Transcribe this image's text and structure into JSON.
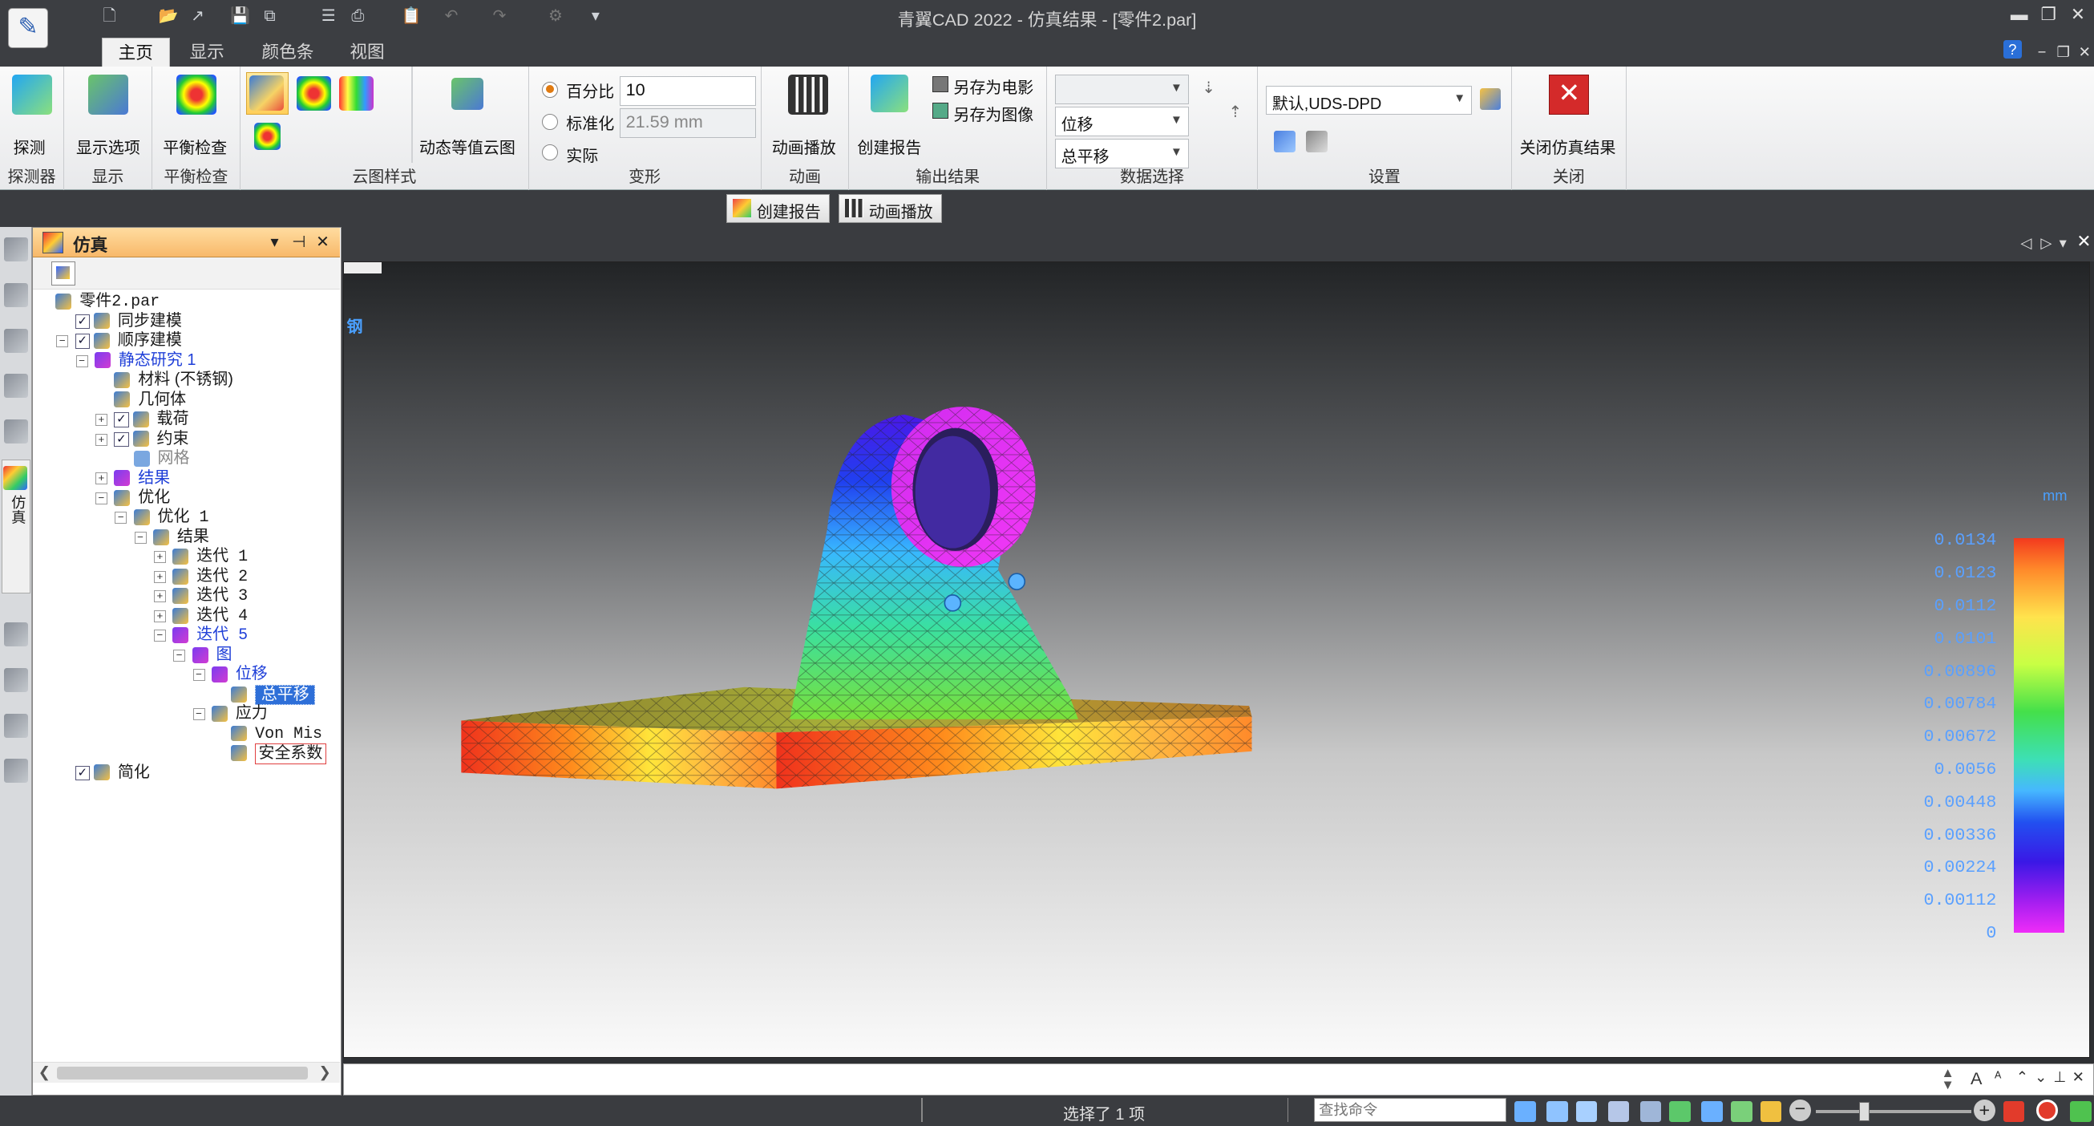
{
  "window": {
    "title": "青翼CAD 2022 - 仿真结果 - [零件2.par]",
    "minimize": "▬",
    "restore": "❐",
    "close": "✕"
  },
  "tabs": [
    {
      "label": "主页",
      "active": true
    },
    {
      "label": "显示"
    },
    {
      "label": "颜色条"
    },
    {
      "label": "视图"
    }
  ],
  "ribbon": {
    "groups": {
      "probe": {
        "label": "探测器",
        "buttons": [
          "探测"
        ]
      },
      "display": {
        "label": "显示",
        "buttons": [
          "显示选项"
        ]
      },
      "balance": {
        "label": "平衡检查",
        "buttons": [
          "平衡检查"
        ]
      },
      "contour": {
        "label": "云图样式",
        "buttons": [
          "动态等值云图"
        ]
      },
      "deform": {
        "label": "变形",
        "options": [
          "百分比",
          "标准化",
          "实际"
        ],
        "percent_value": "10",
        "normalized_value": "21.59 mm"
      },
      "anim": {
        "label": "动画",
        "buttons": [
          "动画播放"
        ]
      },
      "output": {
        "label": "输出结果",
        "buttons": [
          "创建报告",
          "另存为电影",
          "另存为图像"
        ]
      },
      "datasel": {
        "label": "数据选择",
        "combo1": "",
        "combo2": "位移",
        "combo3": "总平移"
      },
      "settings": {
        "label": "设置",
        "combo": "默认,UDS-DPD"
      },
      "close": {
        "label": "关闭",
        "buttons": [
          "关闭仿真结果"
        ]
      }
    }
  },
  "strip": {
    "create_report": "创建报告",
    "play_animation": "动画播放"
  },
  "pane": {
    "title": "仿真",
    "tree": [
      {
        "label": "零件2.par",
        "indent": 0,
        "mono": true
      },
      {
        "label": "同步建模",
        "indent": 1,
        "check": true
      },
      {
        "label": "顺序建模",
        "indent": 1,
        "check": true,
        "toggle": "−"
      },
      {
        "label": "静态研究 1",
        "indent": 2,
        "toggle": "−",
        "blue": true
      },
      {
        "label": "材料 (不锈钢)",
        "indent": 3
      },
      {
        "label": "几何体",
        "indent": 3
      },
      {
        "label": "载荷",
        "indent": 3,
        "check": true,
        "toggle": "+"
      },
      {
        "label": "约束",
        "indent": 3,
        "check": true,
        "toggle": "+"
      },
      {
        "label": "网格",
        "indent": 4,
        "gray": true
      },
      {
        "label": "结果",
        "indent": 3,
        "toggle": "+",
        "blue": true
      },
      {
        "label": "优化",
        "indent": 3,
        "toggle": "−"
      },
      {
        "label": "优化 1",
        "indent": 4,
        "toggle": "−",
        "mono": true
      },
      {
        "label": "结果",
        "indent": 5,
        "toggle": "−"
      },
      {
        "label": "迭代 1",
        "indent": 6,
        "toggle": "+",
        "mono": true
      },
      {
        "label": "迭代 2",
        "indent": 6,
        "toggle": "+",
        "mono": true
      },
      {
        "label": "迭代 3",
        "indent": 6,
        "toggle": "+",
        "mono": true
      },
      {
        "label": "迭代 4",
        "indent": 6,
        "toggle": "+",
        "mono": true
      },
      {
        "label": "迭代 5",
        "indent": 6,
        "toggle": "−",
        "blue": true,
        "mono": true
      },
      {
        "label": "图",
        "indent": 7,
        "toggle": "−",
        "blue": true
      },
      {
        "label": "位移",
        "indent": 8,
        "toggle": "−",
        "blue": true
      },
      {
        "label": "总平移",
        "indent": 9,
        "selected": true
      },
      {
        "label": "应力",
        "indent": 8,
        "toggle": "−"
      },
      {
        "label": "Von Mis",
        "indent": 9,
        "mono": true
      },
      {
        "label": "安全系数",
        "indent": 9,
        "boxed": true
      },
      {
        "label": "简化",
        "indent": 1,
        "check": true
      }
    ]
  },
  "viewport": {
    "material_label": "钢",
    "unit": "mm",
    "legend": [
      "0.0134",
      "0.0123",
      "0.0112",
      "0.0101",
      "0.00896",
      "0.00784",
      "0.00672",
      "0.0056",
      "0.00448",
      "0.00336",
      "0.00224",
      "0.00112",
      "0"
    ]
  },
  "status": {
    "selection": "选择了 1 项",
    "search_placeholder": "查找命令"
  }
}
